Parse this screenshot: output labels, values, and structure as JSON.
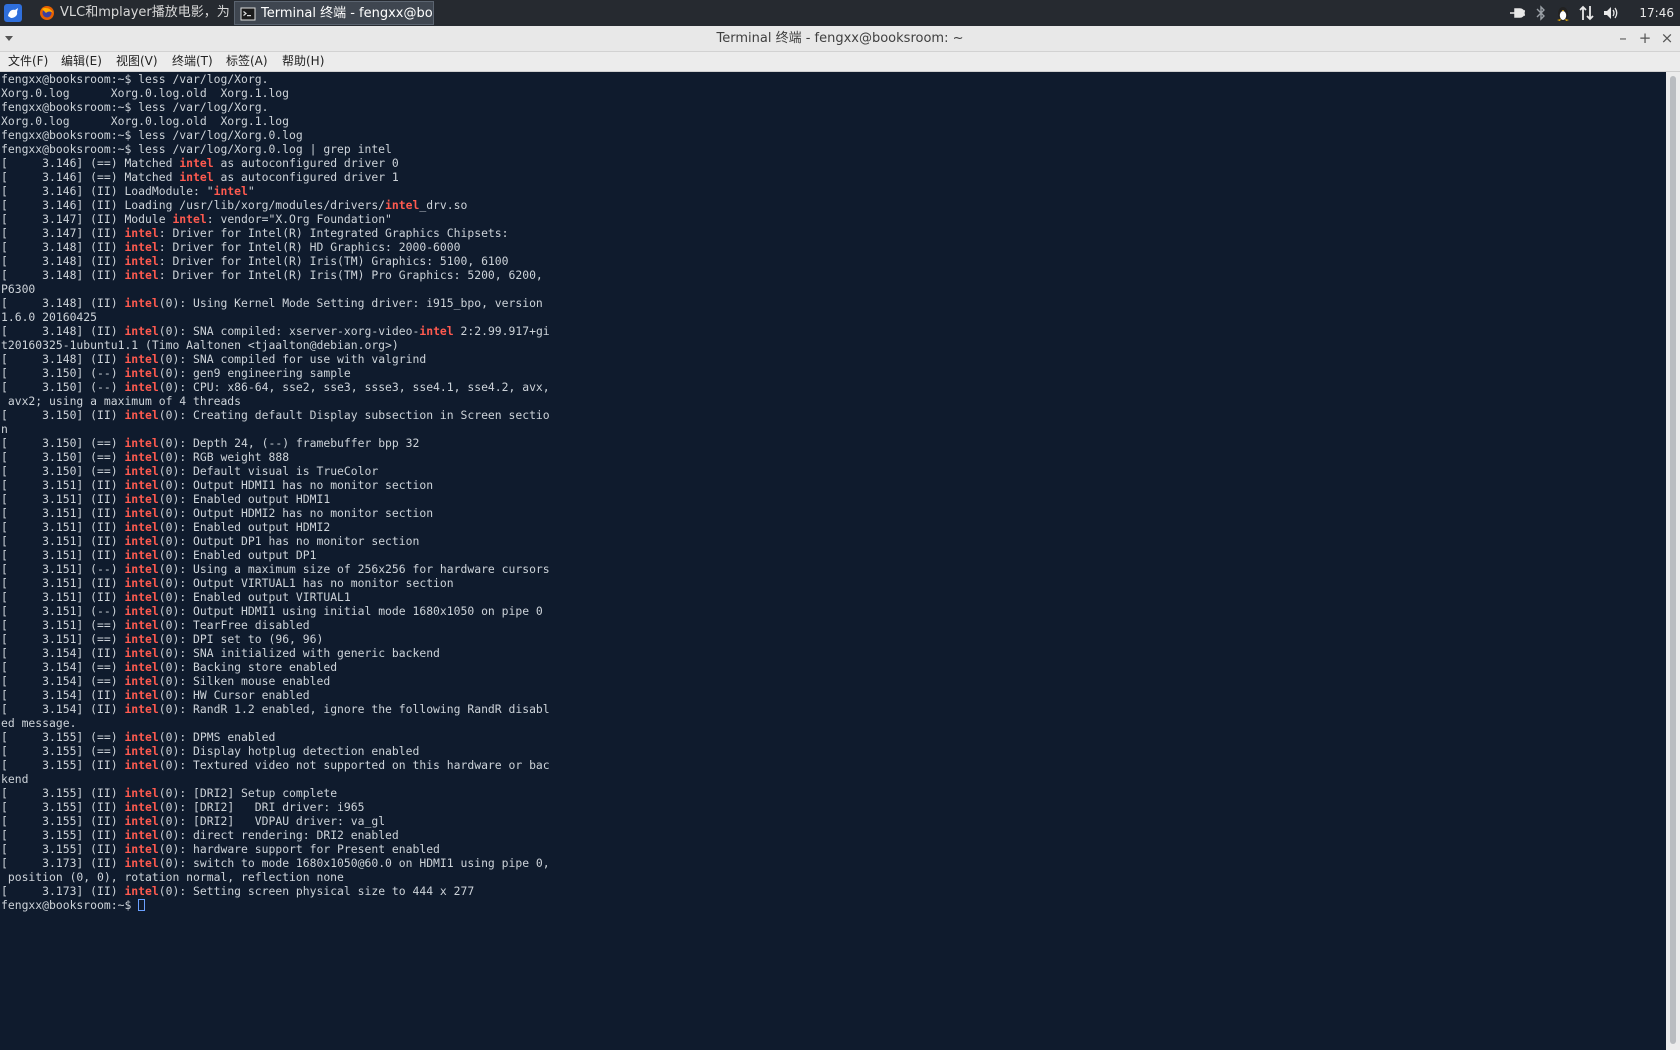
{
  "panel": {
    "tasks": [
      {
        "label": "VLC和mplayer播放电影，为..."
      },
      {
        "label": "Terminal 终端 - fengxx@boo..."
      }
    ],
    "clock": "17:46",
    "icons": [
      "app-menu-icon",
      "firefox-icon",
      "terminal-icon",
      "power-plug-icon",
      "bluetooth-icon",
      "tux-icon",
      "network-arrows-icon",
      "volume-icon"
    ]
  },
  "window": {
    "title": "Terminal 终端 - fengxx@booksroom: ~",
    "buttons": {
      "minimize": "–",
      "maximize": "+",
      "close": "×"
    }
  },
  "menubar": [
    {
      "label": "文件(F)"
    },
    {
      "label": "编辑(E)"
    },
    {
      "label": "视图(V)"
    },
    {
      "label": "终端(T)"
    },
    {
      "label": "标签(A)"
    },
    {
      "label": "帮助(H)"
    }
  ],
  "terminal": {
    "highlight_word": "intel",
    "lines": [
      "fengxx@booksroom:~$ less /var/log/Xorg.",
      "Xorg.0.log      Xorg.0.log.old  Xorg.1.log",
      "fengxx@booksroom:~$ less /var/log/Xorg.",
      "Xorg.0.log      Xorg.0.log.old  Xorg.1.log",
      "fengxx@booksroom:~$ less /var/log/Xorg.0.log",
      "fengxx@booksroom:~$ less /var/log/Xorg.0.log | grep intel",
      "[     3.146] (==) Matched intel as autoconfigured driver 0",
      "[     3.146] (==) Matched intel as autoconfigured driver 1",
      "[     3.146] (II) LoadModule: \"intel\"",
      "[     3.146] (II) Loading /usr/lib/xorg/modules/drivers/intel_drv.so",
      "[     3.147] (II) Module intel: vendor=\"X.Org Foundation\"",
      "[     3.147] (II) intel: Driver for Intel(R) Integrated Graphics Chipsets:",
      "[     3.148] (II) intel: Driver for Intel(R) HD Graphics: 2000-6000",
      "[     3.148] (II) intel: Driver for Intel(R) Iris(TM) Graphics: 5100, 6100",
      "[     3.148] (II) intel: Driver for Intel(R) Iris(TM) Pro Graphics: 5200, 6200,",
      "P6300",
      "[     3.148] (II) intel(0): Using Kernel Mode Setting driver: i915_bpo, version",
      "1.6.0 20160425",
      "[     3.148] (II) intel(0): SNA compiled: xserver-xorg-video-intel 2:2.99.917+gi",
      "t20160325-1ubuntu1.1 (Timo Aaltonen <tjaalton@debian.org>)",
      "[     3.148] (II) intel(0): SNA compiled for use with valgrind",
      "[     3.150] (--) intel(0): gen9 engineering sample",
      "[     3.150] (--) intel(0): CPU: x86-64, sse2, sse3, ssse3, sse4.1, sse4.2, avx,",
      " avx2; using a maximum of 4 threads",
      "[     3.150] (II) intel(0): Creating default Display subsection in Screen sectio",
      "n",
      "[     3.150] (==) intel(0): Depth 24, (--) framebuffer bpp 32",
      "[     3.150] (==) intel(0): RGB weight 888",
      "[     3.150] (==) intel(0): Default visual is TrueColor",
      "[     3.151] (II) intel(0): Output HDMI1 has no monitor section",
      "[     3.151] (II) intel(0): Enabled output HDMI1",
      "[     3.151] (II) intel(0): Output HDMI2 has no monitor section",
      "[     3.151] (II) intel(0): Enabled output HDMI2",
      "[     3.151] (II) intel(0): Output DP1 has no monitor section",
      "[     3.151] (II) intel(0): Enabled output DP1",
      "[     3.151] (--) intel(0): Using a maximum size of 256x256 for hardware cursors",
      "[     3.151] (II) intel(0): Output VIRTUAL1 has no monitor section",
      "[     3.151] (II) intel(0): Enabled output VIRTUAL1",
      "[     3.151] (--) intel(0): Output HDMI1 using initial mode 1680x1050 on pipe 0",
      "[     3.151] (==) intel(0): TearFree disabled",
      "[     3.151] (==) intel(0): DPI set to (96, 96)",
      "[     3.154] (II) intel(0): SNA initialized with generic backend",
      "[     3.154] (==) intel(0): Backing store enabled",
      "[     3.154] (==) intel(0): Silken mouse enabled",
      "[     3.154] (II) intel(0): HW Cursor enabled",
      "[     3.154] (II) intel(0): RandR 1.2 enabled, ignore the following RandR disabl",
      "ed message.",
      "[     3.155] (==) intel(0): DPMS enabled",
      "[     3.155] (==) intel(0): Display hotplug detection enabled",
      "[     3.155] (II) intel(0): Textured video not supported on this hardware or bac",
      "kend",
      "[     3.155] (II) intel(0): [DRI2] Setup complete",
      "[     3.155] (II) intel(0): [DRI2]   DRI driver: i965",
      "[     3.155] (II) intel(0): [DRI2]   VDPAU driver: va_gl",
      "[     3.155] (II) intel(0): direct rendering: DRI2 enabled",
      "[     3.155] (II) intel(0): hardware support for Present enabled",
      "[     3.173] (II) intel(0): switch to mode 1680x1050@60.0 on HDMI1 using pipe 0,",
      " position (0, 0), rotation normal, reflection none",
      "[     3.173] (II) intel(0): Setting screen physical size to 444 x 277"
    ],
    "prompt": "fengxx@booksroom:~$ "
  }
}
